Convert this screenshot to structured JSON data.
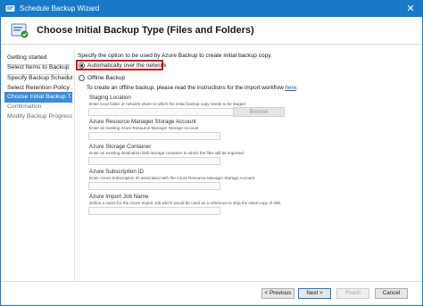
{
  "window": {
    "title": "Schedule Backup Wizard",
    "close_glyph": "✕",
    "accent_color": "#1979c9"
  },
  "header": {
    "title": "Choose Initial Backup Type (Files and Folders)",
    "icon": "backup-wizard-icon"
  },
  "sidebar": {
    "items": [
      {
        "label": "Getting started",
        "state": "normal"
      },
      {
        "label": "Select Items to Backup",
        "state": "normal"
      },
      {
        "label": "Specify Backup Schedule ...",
        "state": "normal"
      },
      {
        "label": "Select Retention Policy ...",
        "state": "normal"
      },
      {
        "label": "Choose Initial Backup T...",
        "state": "active"
      },
      {
        "label": "Confirmation",
        "state": "disabled"
      },
      {
        "label": "Modify Backup Progress",
        "state": "disabled"
      }
    ]
  },
  "main": {
    "intro": "Specify the option to be used by Azure Backup to create initial backup copy.",
    "options": [
      {
        "label": "Automatically over the network",
        "checked": true
      },
      {
        "label": "Offline Backup",
        "checked": false
      }
    ],
    "offline_note": "To create an offline backup, please read the instructions for the import workflow",
    "offline_link": "here",
    "offline_note_end": ".",
    "fields": [
      {
        "label": "Staging Location",
        "help": "Enter local folder or network share to which the initial backup copy needs to be staged",
        "value": ""
      },
      {
        "label": "Azure Resource Manager Storage Account",
        "help": "Enter an existing Azure Resource Manager Storage Account",
        "value": ""
      },
      {
        "label": "Azure Storage Container",
        "help": "Enter an existing destination blob storage container to which the files will be imported",
        "value": ""
      },
      {
        "label": "Azure Subscription ID",
        "help": "Enter Azure Subscription ID associated with the Azure Resource Manager Storage Account",
        "value": ""
      },
      {
        "label": "Azure Import Job Name",
        "help": "Define a name for the Azure Import Job which would be used as a reference to ship the initial copy of disk",
        "value": ""
      }
    ],
    "browse_label": "Browse"
  },
  "footer": {
    "previous_label": "< Previous",
    "next_label": "Next >",
    "finish_label": "Finish",
    "cancel_label": "Cancel"
  }
}
